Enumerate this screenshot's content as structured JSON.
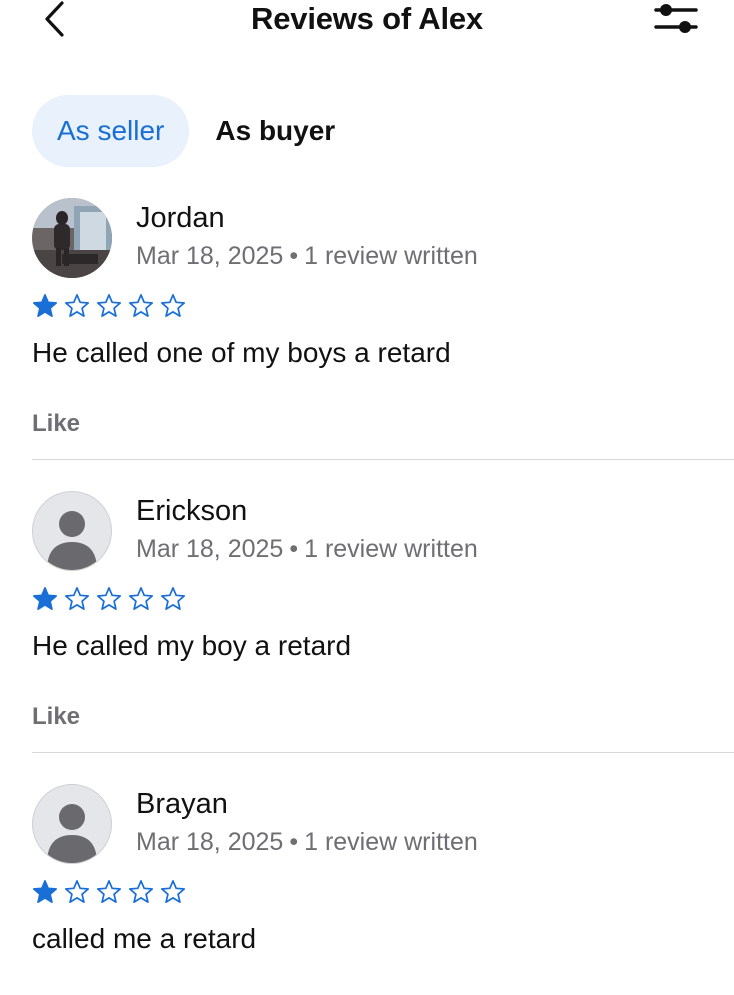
{
  "header": {
    "title": "Reviews of Alex"
  },
  "tabs": [
    {
      "label": "As seller",
      "active": true
    },
    {
      "label": "As buyer",
      "active": false
    }
  ],
  "reviews": [
    {
      "name": "Jordan",
      "date": "Mar 18, 2025",
      "separator": "•",
      "reviews_written": "1 review written",
      "rating": 1,
      "rating_max": 5,
      "comment": "He called one of my boys a retard",
      "like_label": "Like",
      "avatar": "photo"
    },
    {
      "name": "Erickson",
      "date": "Mar 18, 2025",
      "separator": "•",
      "reviews_written": "1 review written",
      "rating": 1,
      "rating_max": 5,
      "comment": "He called my boy a retard",
      "like_label": "Like",
      "avatar": "default-person-icon"
    },
    {
      "name": "Brayan",
      "date": "Mar 18, 2025",
      "separator": "•",
      "reviews_written": "1 review written",
      "rating": 1,
      "rating_max": 5,
      "comment": "called me a retard",
      "avatar": "default-person-icon"
    }
  ],
  "colors": {
    "accent": "#1a6fd6",
    "tab_active_bg": "#e8f1fc",
    "secondary_text": "#6e6e73",
    "divider": "#d8d8dc"
  }
}
